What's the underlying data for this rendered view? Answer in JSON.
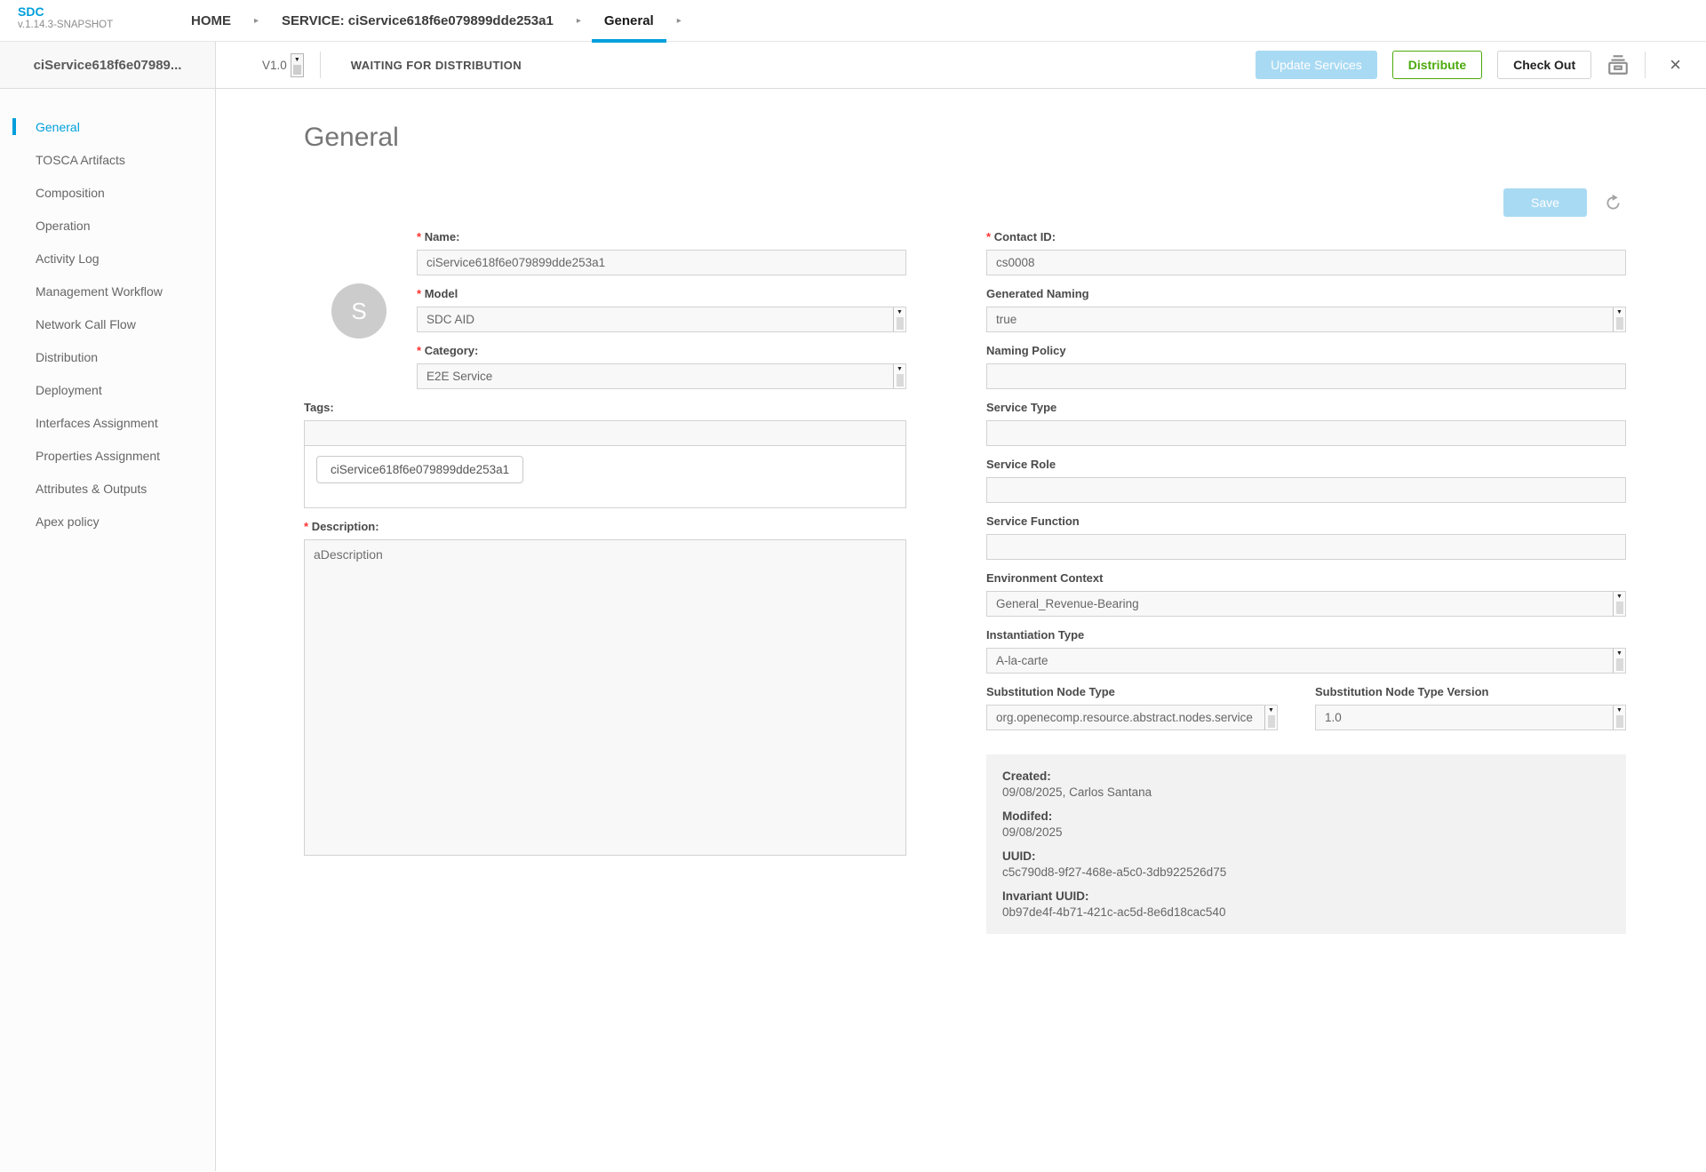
{
  "app": {
    "logo_title": "SDC",
    "logo_version": "v.1.14.3-SNAPSHOT"
  },
  "breadcrumb": {
    "home": "HOME",
    "service": "SERVICE: ciService618f6e079899dde253a1",
    "current": "General"
  },
  "toolbar": {
    "entity_title": "ciService618f6e07989...",
    "version": "V1.0",
    "status": "WAITING FOR DISTRIBUTION",
    "update_services_label": "Update Services",
    "distribute_label": "Distribute",
    "check_out_label": "Check Out"
  },
  "sidebar": {
    "items": [
      {
        "label": "General",
        "active": true
      },
      {
        "label": "TOSCA Artifacts"
      },
      {
        "label": "Composition"
      },
      {
        "label": "Operation"
      },
      {
        "label": "Activity Log"
      },
      {
        "label": "Management Workflow"
      },
      {
        "label": "Network Call Flow"
      },
      {
        "label": "Distribution"
      },
      {
        "label": "Deployment"
      },
      {
        "label": "Interfaces Assignment"
      },
      {
        "label": "Properties Assignment"
      },
      {
        "label": "Attributes & Outputs"
      },
      {
        "label": "Apex policy"
      }
    ]
  },
  "main": {
    "title": "General",
    "save_label": "Save",
    "required_marker": "*",
    "avatar_letter": "S",
    "left": {
      "name": {
        "label": "Name:",
        "value": "ciService618f6e079899dde253a1"
      },
      "model": {
        "label": "Model",
        "value": "SDC AID"
      },
      "category": {
        "label": "Category:",
        "value": "E2E Service"
      },
      "tags": {
        "label": "Tags:",
        "input_value": "",
        "chips": [
          "ciService618f6e079899dde253a1"
        ]
      },
      "description": {
        "label": "Description:",
        "value": "aDescription"
      }
    },
    "right": {
      "contact_id": {
        "label": "Contact ID:",
        "value": "cs0008"
      },
      "generated_naming": {
        "label": "Generated Naming",
        "value": "true"
      },
      "naming_policy": {
        "label": "Naming Policy",
        "value": ""
      },
      "service_type": {
        "label": "Service Type",
        "value": ""
      },
      "service_role": {
        "label": "Service Role",
        "value": ""
      },
      "service_function": {
        "label": "Service Function",
        "value": ""
      },
      "environment_context": {
        "label": "Environment Context",
        "value": "General_Revenue-Bearing"
      },
      "instantiation_type": {
        "label": "Instantiation Type",
        "value": "A-la-carte"
      },
      "substitution_node_type": {
        "label": "Substitution Node Type",
        "value": "org.openecomp.resource.abstract.nodes.service"
      },
      "substitution_node_type_version": {
        "label": "Substitution Node Type Version",
        "value": "1.0"
      }
    },
    "meta": {
      "created_label": "Created:",
      "created_value": "09/08/2025, Carlos Santana",
      "modified_label": "Modifed:",
      "modified_value": "09/08/2025",
      "uuid_label": "UUID:",
      "uuid_value": "c5c790d8-9f27-468e-a5c0-3db922526d75",
      "invariant_uuid_label": "Invariant UUID:",
      "invariant_uuid_value": "0b97de4f-4b71-421c-ac5d-8e6d18cac540"
    }
  },
  "icons": {
    "breadcrumb_arrow": "▸",
    "dropdown_arrow": "▼",
    "close": "×"
  },
  "colors": {
    "accent_blue": "#009fdb",
    "disabled_button_blue": "#a9daf3",
    "distribute_green": "#4ca90c"
  }
}
